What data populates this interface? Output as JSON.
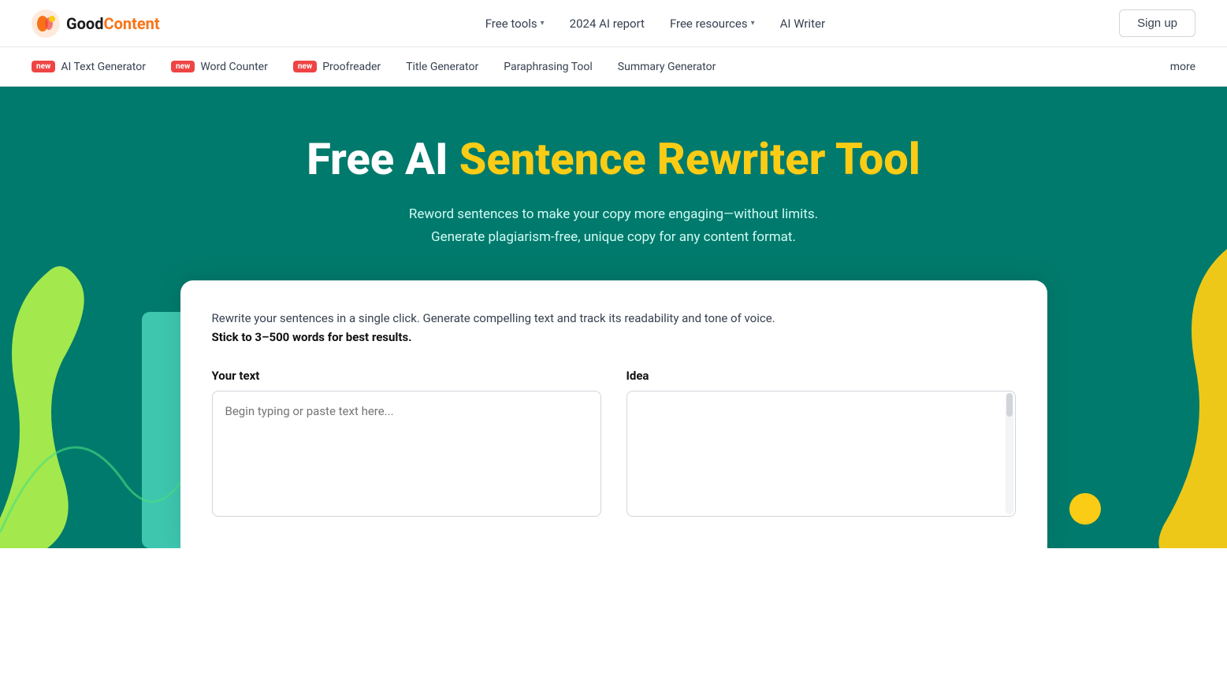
{
  "header": {
    "logo_good": "Good",
    "logo_content": "Content",
    "nav": [
      {
        "label": "Free tools",
        "has_dropdown": true
      },
      {
        "label": "2024 AI report",
        "has_dropdown": false
      },
      {
        "label": "Free resources",
        "has_dropdown": true
      },
      {
        "label": "AI Writer",
        "has_dropdown": false
      }
    ],
    "signup_label": "Sign up"
  },
  "sub_nav": {
    "items": [
      {
        "label": "AI Text Generator",
        "is_new": true
      },
      {
        "label": "Word Counter",
        "is_new": true
      },
      {
        "label": "Proofreader",
        "is_new": true
      },
      {
        "label": "Title Generator",
        "is_new": false
      },
      {
        "label": "Paraphrasing Tool",
        "is_new": false
      },
      {
        "label": "Summary Generator",
        "is_new": false
      }
    ],
    "more_label": "more"
  },
  "hero": {
    "title_prefix": "Free AI ",
    "title_highlight": "Sentence Rewriter Tool",
    "subtitle_line1": "Reword sentences to make your copy more engaging—without limits.",
    "subtitle_line2": "Generate plagiarism-free, unique copy for any content format."
  },
  "tool_card": {
    "intro": "Rewrite your sentences in a single click. Generate compelling text and track its readability and tone of voice.",
    "bold_text": "Stick to 3–500 words for best results.",
    "your_text_label": "Your text",
    "idea_label": "Idea",
    "placeholder": "Begin typing or paste text here..."
  },
  "new_badge_label": "new",
  "colors": {
    "teal": "#007a6c",
    "accent_yellow": "#facc15",
    "accent_red": "#ef4444",
    "accent_orange": "#f97316"
  }
}
